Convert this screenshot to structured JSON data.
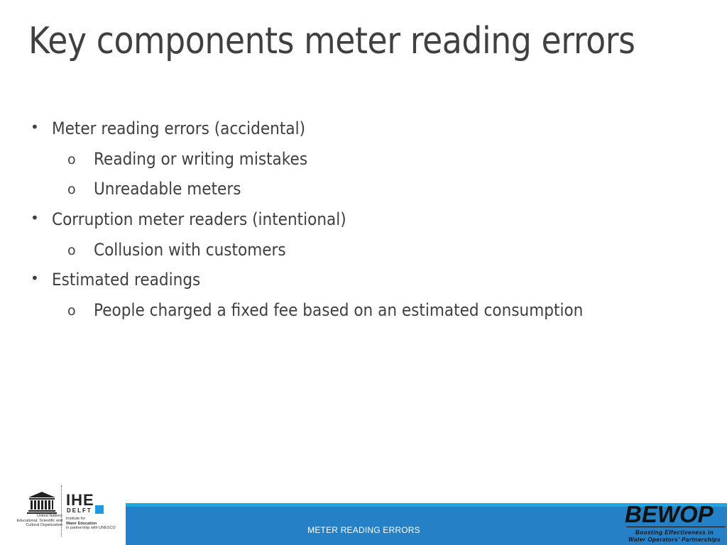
{
  "slide": {
    "title": "Key components meter reading errors",
    "bullets": [
      {
        "level": 1,
        "marker": "•",
        "text": "Meter reading errors (accidental)"
      },
      {
        "level": 2,
        "marker": "o",
        "text": "Reading or writing mistakes"
      },
      {
        "level": 2,
        "marker": "o",
        "text": "Unreadable meters"
      },
      {
        "level": 1,
        "marker": "•",
        "text": "Corruption meter readers (intentional)"
      },
      {
        "level": 2,
        "marker": "o",
        "text": "Collusion with customers"
      },
      {
        "level": 1,
        "marker": "•",
        "text": "Estimated readings"
      },
      {
        "level": 2,
        "marker": "o",
        "text": "People charged a fixed fee based on an estimated consumption"
      }
    ],
    "footer_text": "METER READING ERRORS"
  },
  "logos": {
    "unesco": {
      "caption_lines": [
        "United Nations",
        "Educational, Scientific and",
        "Cultural Organization"
      ]
    },
    "ihe": {
      "word": "IHE",
      "sub": "DELFT",
      "caption_lines": [
        "Institute for",
        "Water Education",
        "in partnership with UNESCO"
      ]
    },
    "bewop": {
      "word": "BEWOP",
      "tagline_lines": [
        "Boosting Effectiveness in",
        "Water Operators' Partnerships"
      ]
    }
  },
  "colors": {
    "footer_band": "#2680c6",
    "footer_stripe": "#1ea8e0",
    "ihe_square": "#1e9be0",
    "text": "#404040"
  }
}
